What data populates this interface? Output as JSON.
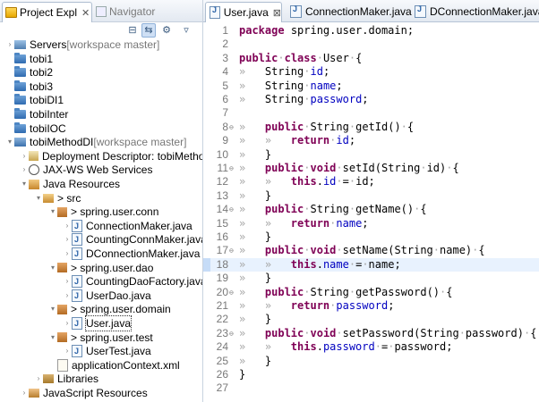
{
  "left_tabs": {
    "project_explorer": "Project Expl",
    "navigator": "Navigator"
  },
  "tree": [
    {
      "label": "Servers",
      "deco": " [workspace master]",
      "indent": 0,
      "arrow": "›",
      "icon": "servers"
    },
    {
      "label": "tobi1",
      "indent": 0,
      "arrow": "",
      "icon": "folder"
    },
    {
      "label": "tobi2",
      "indent": 0,
      "arrow": "",
      "icon": "folder"
    },
    {
      "label": "tobi3",
      "indent": 0,
      "arrow": "",
      "icon": "folder"
    },
    {
      "label": "tobiDI1",
      "indent": 0,
      "arrow": "",
      "icon": "folder"
    },
    {
      "label": "tobiInter",
      "indent": 0,
      "arrow": "",
      "icon": "folder"
    },
    {
      "label": "tobiIOC",
      "indent": 0,
      "arrow": "",
      "icon": "folder"
    },
    {
      "label": "tobiMethodDI",
      "deco": " [workspace master]",
      "indent": 0,
      "arrow": "▾",
      "icon": "project"
    },
    {
      "label": "Deployment Descriptor: tobiMethodDI",
      "indent": 1,
      "arrow": "›",
      "icon": "dd"
    },
    {
      "label": "JAX-WS Web Services",
      "indent": 1,
      "arrow": "›",
      "icon": "ws"
    },
    {
      "label": "Java Resources",
      "indent": 1,
      "arrow": "▾",
      "icon": "jres"
    },
    {
      "label": "> src",
      "indent": 2,
      "arrow": "▾",
      "icon": "srcf"
    },
    {
      "label": "> spring.user.conn",
      "indent": 3,
      "arrow": "▾",
      "icon": "pkg"
    },
    {
      "label": "ConnectionMaker.java",
      "indent": 4,
      "arrow": "›",
      "icon": "jfile"
    },
    {
      "label": "CountingConnMaker.java",
      "indent": 4,
      "arrow": "›",
      "icon": "jfile"
    },
    {
      "label": "DConnectionMaker.java",
      "indent": 4,
      "arrow": "›",
      "icon": "jfile"
    },
    {
      "label": "> spring.user.dao",
      "indent": 3,
      "arrow": "▾",
      "icon": "pkg"
    },
    {
      "label": "CountingDaoFactory.java",
      "indent": 4,
      "arrow": "›",
      "icon": "jfile"
    },
    {
      "label": "UserDao.java",
      "indent": 4,
      "arrow": "›",
      "icon": "jfile"
    },
    {
      "label": "> spring.user.domain",
      "indent": 3,
      "arrow": "▾",
      "icon": "pkg"
    },
    {
      "label": "User.java",
      "indent": 4,
      "arrow": "›",
      "icon": "jfile",
      "selected": true
    },
    {
      "label": "> spring.user.test",
      "indent": 3,
      "arrow": "▾",
      "icon": "pkg"
    },
    {
      "label": "UserTest.java",
      "indent": 4,
      "arrow": "›",
      "icon": "jfile"
    },
    {
      "label": "applicationContext.xml",
      "indent": 3,
      "arrow": "",
      "icon": "xml"
    },
    {
      "label": "Libraries",
      "indent": 2,
      "arrow": "›",
      "icon": "lib"
    },
    {
      "label": "JavaScript Resources",
      "indent": 1,
      "arrow": "›",
      "icon": "jsr"
    }
  ],
  "editor_tabs": [
    {
      "label": "User.java",
      "close": "⊠",
      "active": true
    },
    {
      "label": "ConnectionMaker.java",
      "active": false
    },
    {
      "label": "DConnectionMaker.java",
      "active": false
    }
  ],
  "code_lines": [
    {
      "n": "1",
      "fold": "",
      "hl": false,
      "tokens": [
        [
          "kw",
          "package"
        ],
        [
          "ws",
          " "
        ],
        [
          "",
          "spring.user.domain;"
        ]
      ]
    },
    {
      "n": "2",
      "fold": "",
      "hl": false,
      "tokens": []
    },
    {
      "n": "3",
      "fold": "",
      "hl": false,
      "tokens": [
        [
          "kw",
          "public"
        ],
        [
          "ws",
          "·"
        ],
        [
          "kw",
          "class"
        ],
        [
          "ws",
          "·"
        ],
        [
          "",
          "User"
        ],
        [
          "ws",
          "·"
        ],
        [
          "",
          "{"
        ]
      ]
    },
    {
      "n": "4",
      "fold": "",
      "hl": false,
      "tokens": [
        [
          "ws",
          "»   "
        ],
        [
          "",
          "String"
        ],
        [
          "ws",
          "·"
        ],
        [
          "fld",
          "id"
        ],
        [
          "",
          "; "
        ]
      ]
    },
    {
      "n": "5",
      "fold": "",
      "hl": false,
      "tokens": [
        [
          "ws",
          "»   "
        ],
        [
          "",
          "String"
        ],
        [
          "ws",
          "·"
        ],
        [
          "fld",
          "name"
        ],
        [
          "",
          ";"
        ]
      ]
    },
    {
      "n": "6",
      "fold": "",
      "hl": false,
      "tokens": [
        [
          "ws",
          "»   "
        ],
        [
          "",
          "String"
        ],
        [
          "ws",
          "·"
        ],
        [
          "fld",
          "password"
        ],
        [
          "",
          ";"
        ]
      ]
    },
    {
      "n": "7",
      "fold": "",
      "hl": false,
      "tokens": []
    },
    {
      "n": "8",
      "fold": "⊖",
      "hl": false,
      "tokens": [
        [
          "ws",
          "»   "
        ],
        [
          "kw",
          "public"
        ],
        [
          "ws",
          "·"
        ],
        [
          "",
          "String"
        ],
        [
          "ws",
          "·"
        ],
        [
          "",
          "getId()"
        ],
        [
          "ws",
          "·"
        ],
        [
          "",
          "{"
        ]
      ]
    },
    {
      "n": "9",
      "fold": "",
      "hl": false,
      "tokens": [
        [
          "ws",
          "»   »   "
        ],
        [
          "kw",
          "return"
        ],
        [
          "ws",
          "·"
        ],
        [
          "fld",
          "id"
        ],
        [
          "",
          ";"
        ]
      ]
    },
    {
      "n": "10",
      "fold": "",
      "hl": false,
      "tokens": [
        [
          "ws",
          "»   "
        ],
        [
          "",
          "}"
        ]
      ]
    },
    {
      "n": "11",
      "fold": "⊖",
      "hl": false,
      "tokens": [
        [
          "ws",
          "»   "
        ],
        [
          "kw",
          "public"
        ],
        [
          "ws",
          "·"
        ],
        [
          "kw",
          "void"
        ],
        [
          "ws",
          "·"
        ],
        [
          "",
          "setId(String"
        ],
        [
          "ws",
          "·"
        ],
        [
          "",
          "id)"
        ],
        [
          "ws",
          "·"
        ],
        [
          "",
          "{"
        ]
      ]
    },
    {
      "n": "12",
      "fold": "",
      "hl": false,
      "tokens": [
        [
          "ws",
          "»   »   "
        ],
        [
          "kw",
          "this"
        ],
        [
          "",
          "."
        ],
        [
          "fld",
          "id"
        ],
        [
          "ws",
          "·"
        ],
        [
          "",
          "="
        ],
        [
          "ws",
          "·"
        ],
        [
          "",
          "id;"
        ]
      ]
    },
    {
      "n": "13",
      "fold": "",
      "hl": false,
      "tokens": [
        [
          "ws",
          "»   "
        ],
        [
          "",
          "}"
        ]
      ]
    },
    {
      "n": "14",
      "fold": "⊖",
      "hl": false,
      "tokens": [
        [
          "ws",
          "»   "
        ],
        [
          "kw",
          "public"
        ],
        [
          "ws",
          "·"
        ],
        [
          "",
          "String"
        ],
        [
          "ws",
          "·"
        ],
        [
          "",
          "getName()"
        ],
        [
          "ws",
          "·"
        ],
        [
          "",
          "{"
        ]
      ]
    },
    {
      "n": "15",
      "fold": "",
      "hl": false,
      "tokens": [
        [
          "ws",
          "»   »   "
        ],
        [
          "kw",
          "return"
        ],
        [
          "ws",
          "·"
        ],
        [
          "fld",
          "name"
        ],
        [
          "",
          ";"
        ]
      ]
    },
    {
      "n": "16",
      "fold": "",
      "hl": false,
      "tokens": [
        [
          "ws",
          "»   "
        ],
        [
          "",
          "}"
        ]
      ]
    },
    {
      "n": "17",
      "fold": "⊖",
      "hl": false,
      "tokens": [
        [
          "ws",
          "»   "
        ],
        [
          "kw",
          "public"
        ],
        [
          "ws",
          "·"
        ],
        [
          "kw",
          "void"
        ],
        [
          "ws",
          "·"
        ],
        [
          "",
          "setName(String"
        ],
        [
          "ws",
          "·"
        ],
        [
          "",
          "name)"
        ],
        [
          "ws",
          "·"
        ],
        [
          "",
          "{"
        ]
      ]
    },
    {
      "n": "18",
      "fold": "",
      "hl": true,
      "tokens": [
        [
          "ws",
          "»   »   "
        ],
        [
          "kw",
          "this"
        ],
        [
          "",
          "."
        ],
        [
          "fld",
          "name"
        ],
        [
          "ws",
          "·"
        ],
        [
          "",
          "="
        ],
        [
          "ws",
          "·"
        ],
        [
          "",
          "name;"
        ]
      ]
    },
    {
      "n": "19",
      "fold": "",
      "hl": false,
      "tokens": [
        [
          "ws",
          "»   "
        ],
        [
          "",
          "}"
        ]
      ]
    },
    {
      "n": "20",
      "fold": "⊖",
      "hl": false,
      "tokens": [
        [
          "ws",
          "»   "
        ],
        [
          "kw",
          "public"
        ],
        [
          "ws",
          "·"
        ],
        [
          "",
          "String"
        ],
        [
          "ws",
          "·"
        ],
        [
          "",
          "getPassword()"
        ],
        [
          "ws",
          "·"
        ],
        [
          "",
          "{"
        ]
      ]
    },
    {
      "n": "21",
      "fold": "",
      "hl": false,
      "tokens": [
        [
          "ws",
          "»   »   "
        ],
        [
          "kw",
          "return"
        ],
        [
          "ws",
          "·"
        ],
        [
          "fld",
          "password"
        ],
        [
          "",
          ";"
        ]
      ]
    },
    {
      "n": "22",
      "fold": "",
      "hl": false,
      "tokens": [
        [
          "ws",
          "»   "
        ],
        [
          "",
          "}"
        ]
      ]
    },
    {
      "n": "23",
      "fold": "⊖",
      "hl": false,
      "tokens": [
        [
          "ws",
          "»   "
        ],
        [
          "kw",
          "public"
        ],
        [
          "ws",
          "·"
        ],
        [
          "kw",
          "void"
        ],
        [
          "ws",
          "·"
        ],
        [
          "",
          "setPassword(String"
        ],
        [
          "ws",
          "·"
        ],
        [
          "",
          "password)"
        ],
        [
          "ws",
          "·"
        ],
        [
          "",
          "{"
        ]
      ]
    },
    {
      "n": "24",
      "fold": "",
      "hl": false,
      "tokens": [
        [
          "ws",
          "»   »   "
        ],
        [
          "kw",
          "this"
        ],
        [
          "",
          "."
        ],
        [
          "fld",
          "password"
        ],
        [
          "ws",
          "·"
        ],
        [
          "",
          "="
        ],
        [
          "ws",
          "·"
        ],
        [
          "",
          "password;"
        ]
      ]
    },
    {
      "n": "25",
      "fold": "",
      "hl": false,
      "tokens": [
        [
          "ws",
          "»   "
        ],
        [
          "",
          "}"
        ]
      ]
    },
    {
      "n": "26",
      "fold": "",
      "hl": false,
      "tokens": [
        [
          "",
          "}"
        ]
      ]
    },
    {
      "n": "27",
      "fold": "",
      "hl": false,
      "tokens": []
    }
  ]
}
